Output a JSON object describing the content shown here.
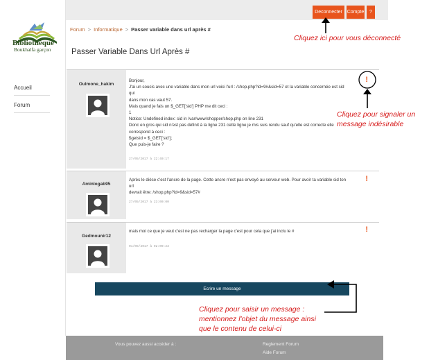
{
  "logo": {
    "title": "Bibliothèque",
    "subtitle": "Boukhalfa garçon"
  },
  "sidebar": {
    "items": [
      {
        "label": "Accueil"
      },
      {
        "label": "Forum"
      }
    ]
  },
  "topbar": {
    "logout_label": "Deconnecter",
    "account_label": "Compte",
    "help_label": "?"
  },
  "breadcrumb": {
    "items": [
      "Forum",
      "Informatique",
      "Passer variable dans url après #"
    ],
    "separator": ">"
  },
  "page_title": "Passer Variable Dans Url Après #",
  "posts": [
    {
      "author": "Oulmone_hakim",
      "lines": [
        "Bonjour,",
        "J'ai un soucis avec une variable dans mon url voici l'url : /shop.php?id=9#&sid=57 et la variable concernée est sid qui",
        "dans mon cas vaut 57.",
        "Mais quand je fais un $_GET['sid'] PHP me dit ceci :",
        "1",
        "Notice: Undefined index: sid in /var/www/shopper/shop.php on line 231",
        "Donc en gros qui sid n'est pas définit à la ligne 231 cette ligne je mis suis rendu sauf qu'elle est correcte elle",
        "correspond à ceci :",
        "$getsid = $_GET['sid'];",
        "Que puis-je faire ?"
      ],
      "date": "27/05/2017 à 22:40:17",
      "report_icon": "!"
    },
    {
      "author": "Aminlogab95",
      "lines": [
        "Après le dièse c'est l'ancre de la page. Cette ancre n'est pas envoyé au serveur web. Pour avoir ta variable sid ton url",
        "devrait être: /shop.php?id=9&sid=57#"
      ],
      "date": "27/05/2017 à 23:00:00",
      "report_icon": "!"
    },
    {
      "author": "Gedmounir12",
      "lines": [
        "mais moi ce que je veut c'est ne pas recharger la page c'est pour cela que j'ai inclu le #"
      ],
      "date": "01/05/2017 à 02:09:23",
      "report_icon": "!"
    }
  ],
  "write_button_label": "Ecrire un message",
  "footer": {
    "access_label": "Vous pouvez aussi accéder à :",
    "links": [
      "Reglement Forum",
      "Aide Forum"
    ]
  },
  "annotations": {
    "logout": "Cliquez ici pour vous déconnecté",
    "report": [
      "Cliquez pour signaler un",
      "message indésirable"
    ],
    "write": [
      "Cliquez pour saisir un message :",
      "mentionnez l'objet du message ainsi",
      "que le contenu de celui-ci"
    ]
  },
  "colors": {
    "accent": "#e8541c",
    "primary_button": "#17475f",
    "annotation": "#d61b1b",
    "footer": "#9a9a9a",
    "topbar": "#ececec",
    "author_column": "#e9e9e9"
  }
}
